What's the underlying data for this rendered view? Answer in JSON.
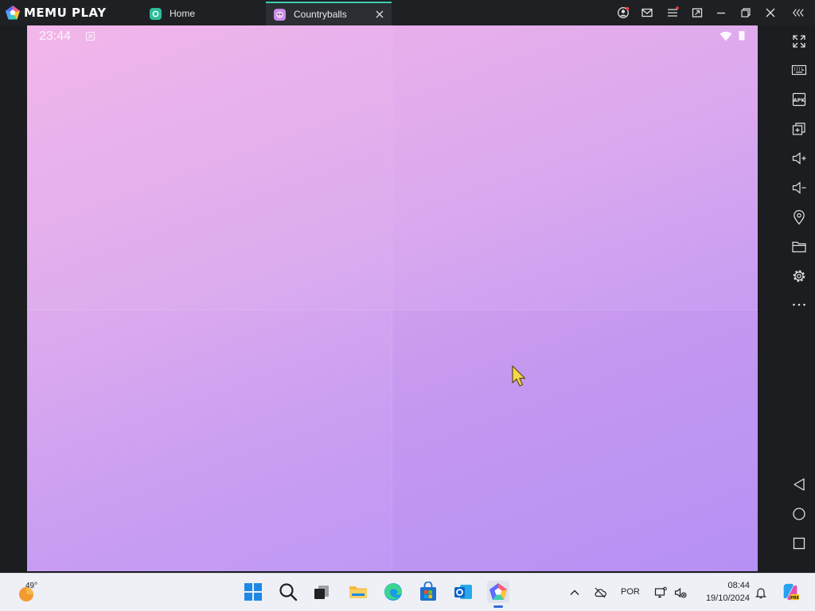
{
  "app": {
    "brand": "MEMU PLAY"
  },
  "tabs": [
    {
      "label": "Home",
      "active": false
    },
    {
      "label": "Countryballs",
      "active": true
    }
  ],
  "titlebar_icons": [
    "account-icon",
    "mail-icon",
    "menu-icon",
    "multi-window-icon",
    "minimize-icon",
    "restore-icon",
    "close-icon",
    "collapse-icon"
  ],
  "android_status": {
    "time": "23:44"
  },
  "sidebar_icons": [
    "fullscreen-icon",
    "keyboard-icon",
    "apk-icon",
    "add-window-icon",
    "volume-up-icon",
    "volume-down-icon",
    "location-icon",
    "folder-icon",
    "settings-icon",
    "more-icon",
    "back-icon",
    "home-icon",
    "recents-icon"
  ],
  "taskbar": {
    "weather_temp": "49°",
    "apps": [
      "start-icon",
      "search-icon",
      "task-view-icon",
      "file-explorer-icon",
      "edge-icon",
      "store-icon",
      "outlook-icon",
      "memu-icon"
    ],
    "language": "POR",
    "time": "08:44",
    "date": "19/10/2024"
  },
  "colors": {
    "accent_tab": "#3ccfb0",
    "screen_gradient_start": "#f3b3ea",
    "screen_gradient_end": "#b994f6",
    "titlebar_bg": "#1e2023",
    "taskbar_bg": "#eef0f6"
  }
}
